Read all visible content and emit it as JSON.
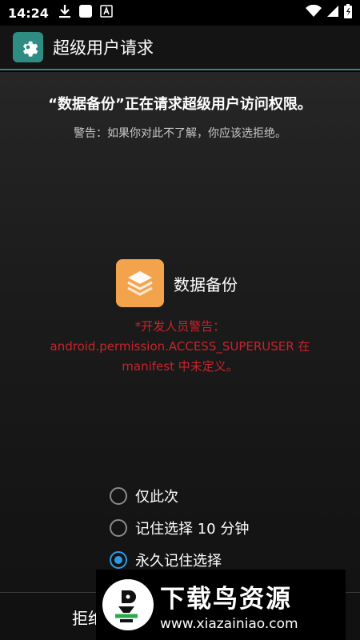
{
  "status_bar": {
    "time": "14:24",
    "icons_left": [
      "download-icon",
      "app-notification-icon",
      "a-icon"
    ],
    "icons_right": [
      "wifi-icon",
      "signal-icon",
      "battery-icon"
    ]
  },
  "app_bar": {
    "title": "超级用户请求",
    "icon": "gear-icon",
    "accent": "#2f8c86"
  },
  "request": {
    "headline": "“数据备份”正在请求超级用户访问权限。",
    "warning": "警告：如果你对此不了解，你应该选拒绝。",
    "app_name": "数据备份",
    "app_icon": "layers-icon",
    "dev_warning_line1": "*开发人员警告：",
    "dev_warning_line2": "android.permission.ACCESS_SUPERUSER 在",
    "dev_warning_line3": "manifest 中未定义。",
    "warning_color": "#c9232b"
  },
  "options": [
    {
      "label": "仅此次",
      "checked": false
    },
    {
      "label": "记住选择 10 分钟",
      "checked": false
    },
    {
      "label": "永久记住选择",
      "checked": true
    }
  ],
  "buttons": {
    "deny_label": "拒绝"
  },
  "watermark": {
    "title": "下载鸟资源",
    "url": "www.xiazainiao.com"
  }
}
